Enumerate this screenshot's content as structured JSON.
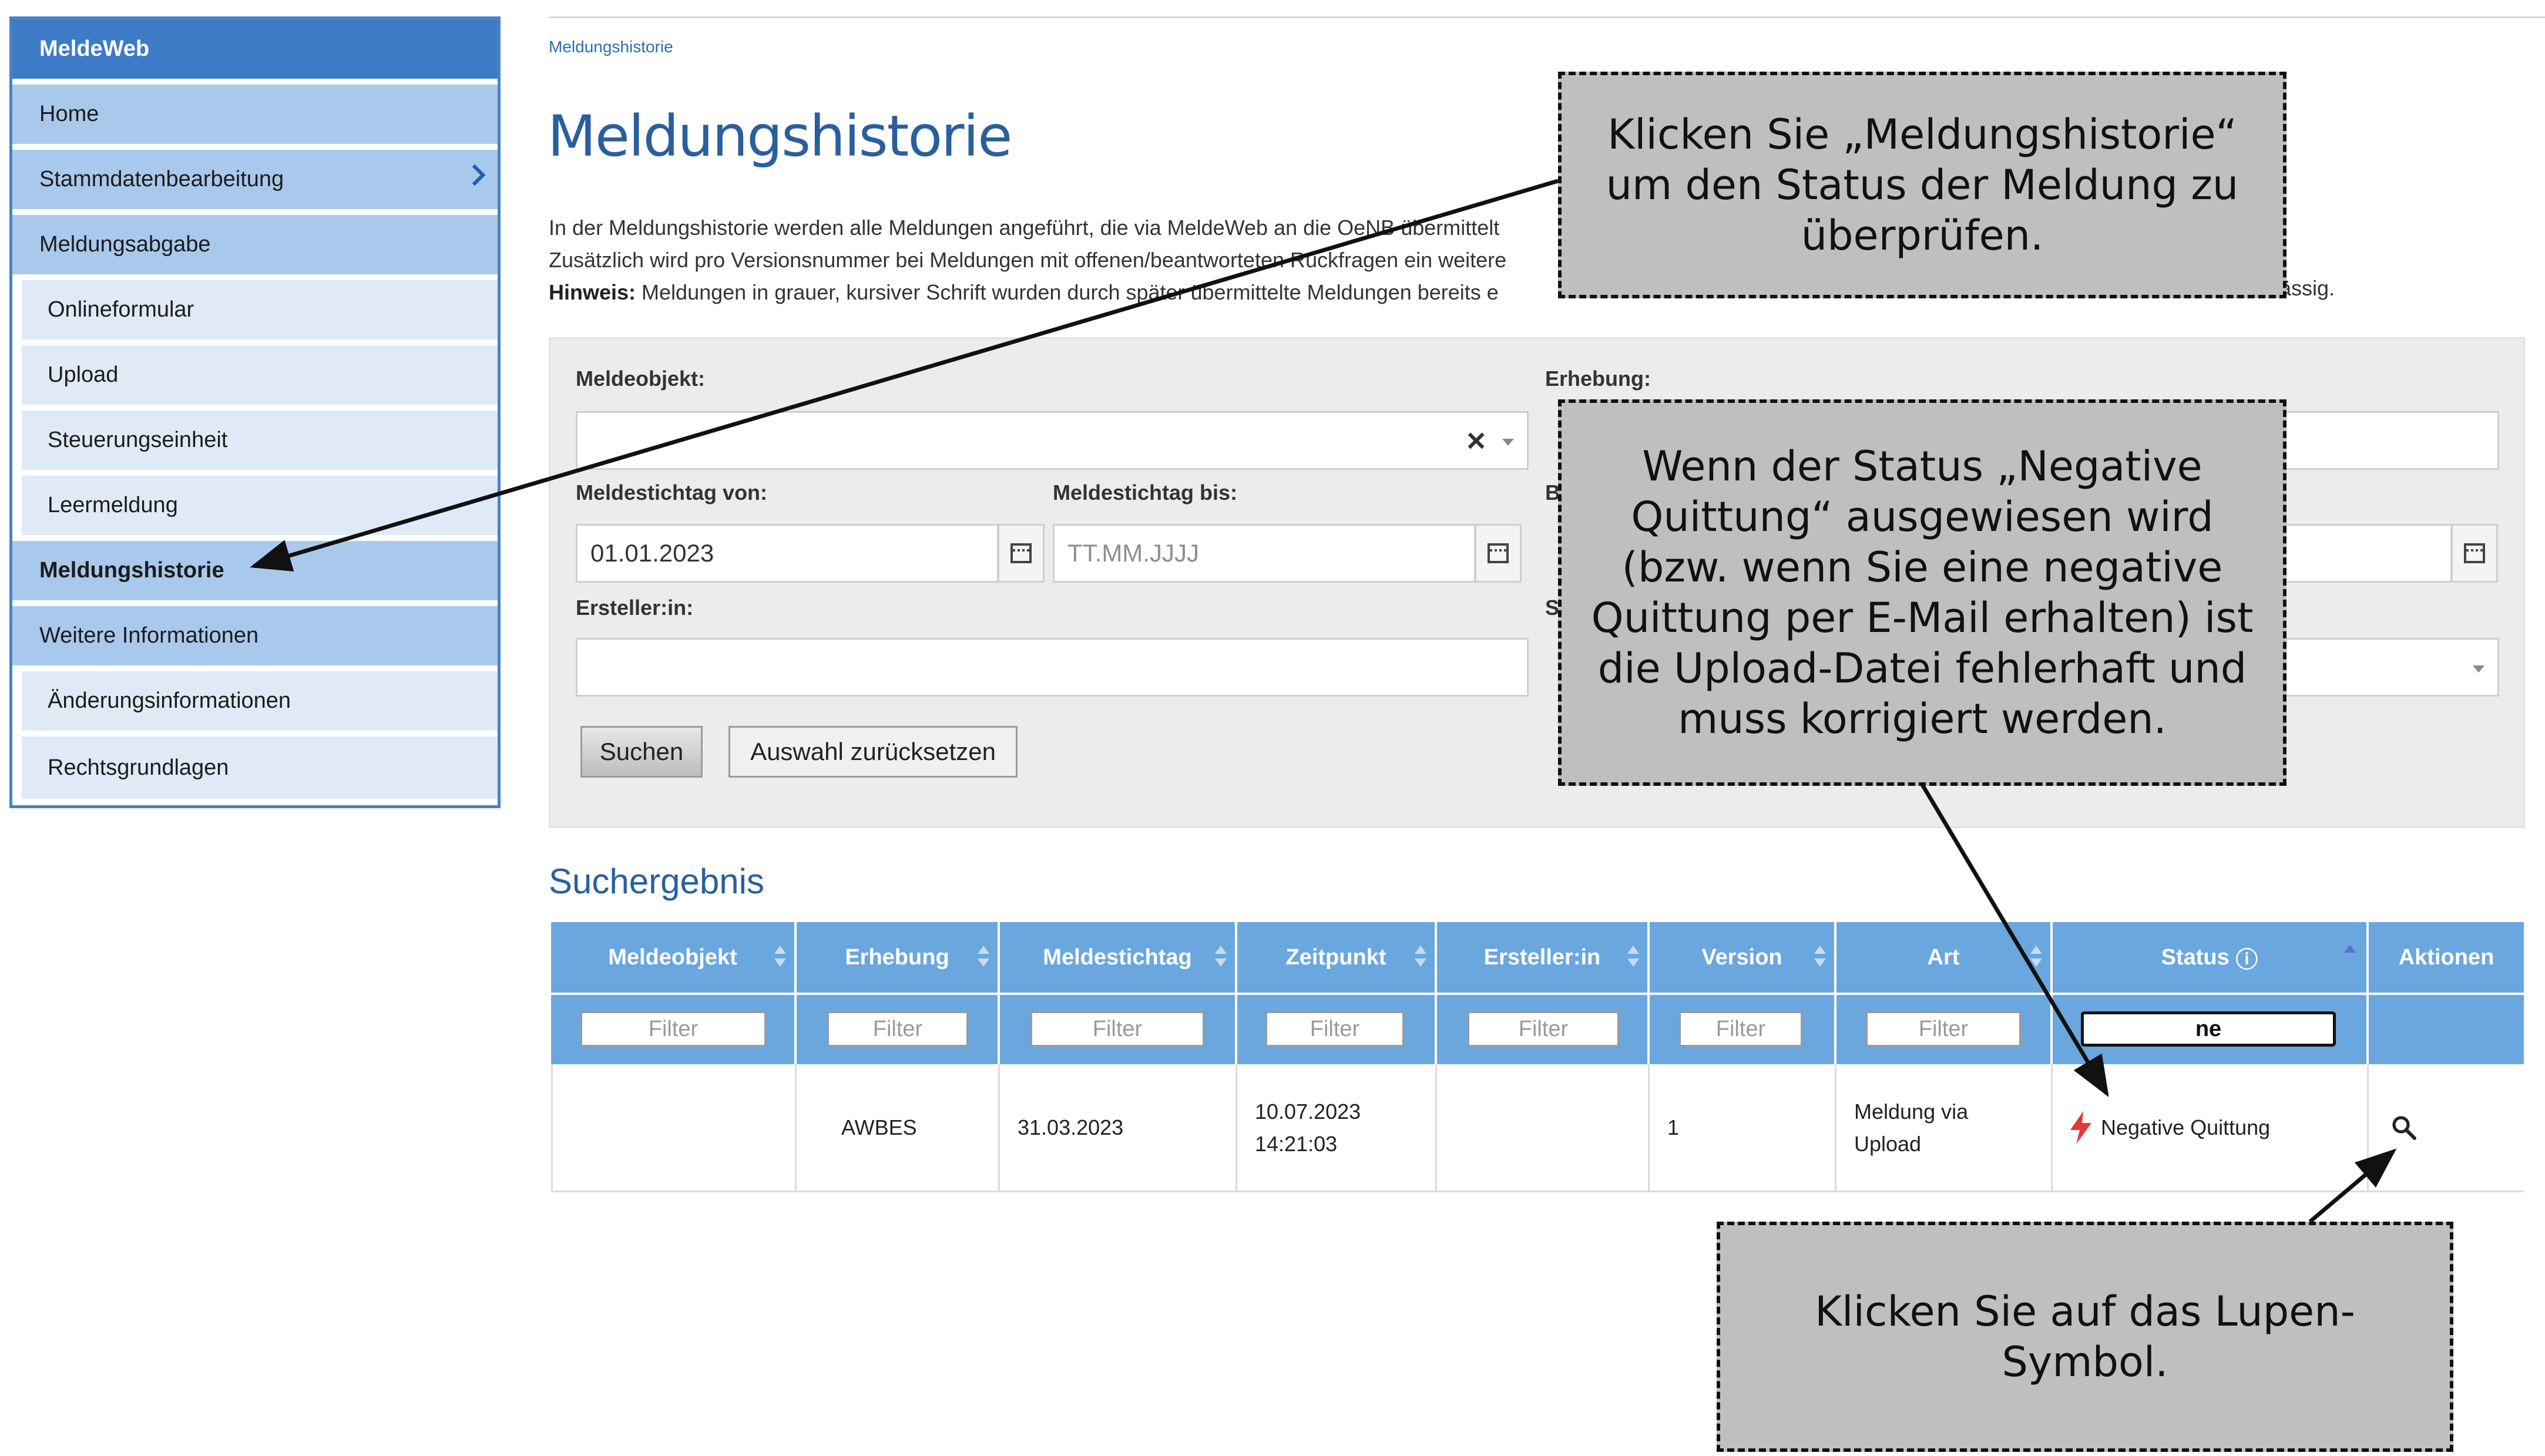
{
  "sidebar": {
    "app_title": "MeldeWeb",
    "items": [
      {
        "label": "Home"
      },
      {
        "label": "Stammdatenbearbeitung"
      },
      {
        "label": "Meldungsabgabe"
      },
      {
        "label": "Onlineformular"
      },
      {
        "label": "Upload"
      },
      {
        "label": "Steuerungseinheit"
      },
      {
        "label": "Leermeldung"
      },
      {
        "label": "Meldungshistorie"
      },
      {
        "label": "Weitere Informationen"
      },
      {
        "label": "Änderungsinformationen"
      },
      {
        "label": "Rechtsgrundlagen"
      }
    ]
  },
  "breadcrumb": "Meldungshistorie",
  "page_title": "Meldungshistorie",
  "intro": {
    "line1": "In der Meldungshistorie werden alle Meldungen angeführt, die via MeldeWeb an die OeNB übermittelt",
    "line2": "Zusätzlich wird pro Versionsnummer bei Meldungen mit offenen/beantworteten Rückfragen ein weitere",
    "hint_label": "Hinweis:",
    "line3": "Meldungen in grauer, kursiver Schrift wurden durch später übermittelte Meldungen bereits e",
    "line3_tail": "ässig."
  },
  "filters": {
    "meldeobjekt_label": "Meldeobjekt:",
    "meldeobjekt_clear": "×",
    "erhebung_label": "Erhebung:",
    "stichtag_von_label": "Meldestichtag von:",
    "stichtag_von_value": "01.01.2023",
    "stichtag_bis_label": "Meldestichtag bis:",
    "stichtag_bis_placeholder": "TT.MM.JJJJ",
    "ersteller_label": "Ersteller:in:",
    "hidden_label_b": "B",
    "hidden_label_s": "S",
    "search_button": "Suchen",
    "reset_button": "Auswahl zurücksetzen"
  },
  "results_title": "Suchergebnis",
  "table": {
    "headers": [
      "Meldeobjekt",
      "Erhebung",
      "Meldestichtag",
      "Zeitpunkt",
      "Ersteller:in",
      "Version",
      "Art",
      "Status",
      "Aktionen"
    ],
    "status_info_icon": "ⓘ",
    "filter_placeholder": "Filter",
    "status_filter_value": "ne",
    "rows": [
      {
        "meldeobjekt": "",
        "erhebung": "AWBES",
        "meldestichtag": "31.03.2023",
        "zeitpunkt_date": "10.07.2023",
        "zeitpunkt_time": "14:21:03",
        "ersteller": "",
        "version": "1",
        "art_line1": "Meldung via",
        "art_line2": "Upload",
        "status": "Negative Quittung",
        "status_icon": "lightning-icon",
        "action_icon": "magnifier-icon"
      }
    ]
  },
  "callouts": {
    "c1": "Klicken Sie „Meldungshistorie“ um den Status der Meldung zu überprüfen.",
    "c2": "Wenn der Status „Negative Quittung“ ausgewiesen wird (bzw. wenn Sie eine negative Quittung per E-Mail erhalten) ist die Upload-Datei fehlerhaft und muss korrigiert werden.",
    "c3": "Klicken Sie auf das Lupen-Symbol."
  },
  "colors": {
    "sidebar_head": "#3e7bc7",
    "sidebar_item": "#a9c9ec",
    "sidebar_subitem": "#dfeaf6",
    "table_header": "#6aa7de",
    "title_blue": "#2a5f9e",
    "error_red": "#e53935",
    "callout_bg": "#bfbfbf"
  }
}
